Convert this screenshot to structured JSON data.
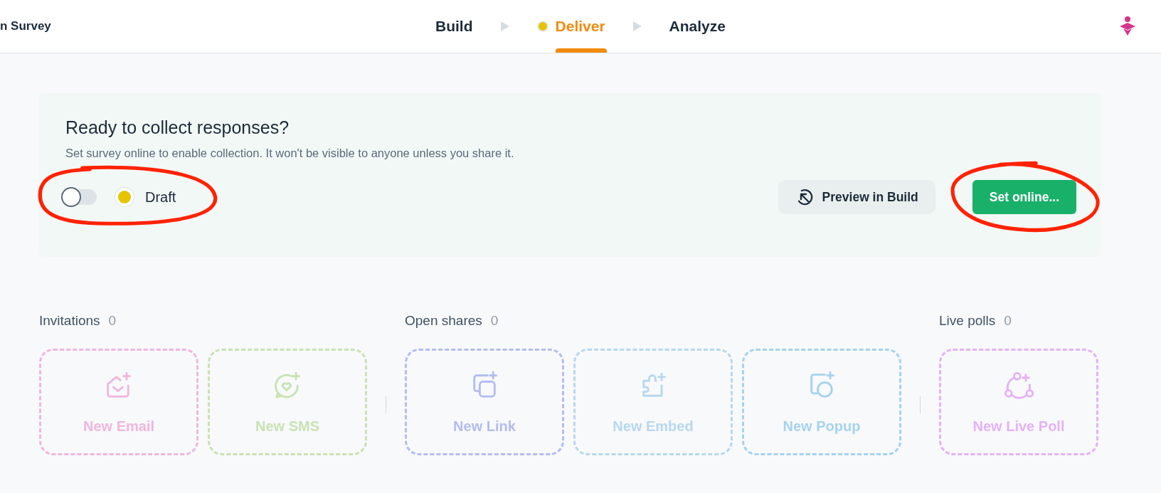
{
  "header": {
    "survey_title": "n Survey",
    "steps": [
      {
        "label": "Build",
        "selected": false,
        "dot": false
      },
      {
        "label": "Deliver",
        "selected": true,
        "dot": true
      },
      {
        "label": "Analyze",
        "selected": false,
        "dot": false
      }
    ]
  },
  "collect_panel": {
    "title": "Ready to collect responses?",
    "subtitle": "Set survey online to enable collection. It won't be visible to anyone unless you share it.",
    "online_toggle": {
      "on": false,
      "annotated": true
    },
    "status": {
      "label": "Draft",
      "color": "#e5c400"
    },
    "preview_button": {
      "label": "Preview in Build"
    },
    "set_online_button": {
      "label": "Set online...",
      "annotated": true
    }
  },
  "sections": [
    {
      "title": "Invitations",
      "count": "0",
      "items": [
        {
          "kind": "email",
          "label": "New Email",
          "color": "#f0b6de"
        },
        {
          "kind": "sms",
          "label": "New SMS",
          "color": "#c9e2b4"
        }
      ]
    },
    {
      "title": "Open shares",
      "count": "0",
      "items": [
        {
          "kind": "link",
          "label": "New Link",
          "color": "#b4bcf2"
        },
        {
          "kind": "embed",
          "label": "New Embed",
          "color": "#b7d8ee"
        },
        {
          "kind": "popup",
          "label": "New Popup",
          "color": "#a6d3ee"
        }
      ]
    },
    {
      "title": "Live polls",
      "count": "0",
      "items": [
        {
          "kind": "live_poll",
          "label": "New Live Poll",
          "color": "#e4b2f7"
        }
      ]
    }
  ]
}
